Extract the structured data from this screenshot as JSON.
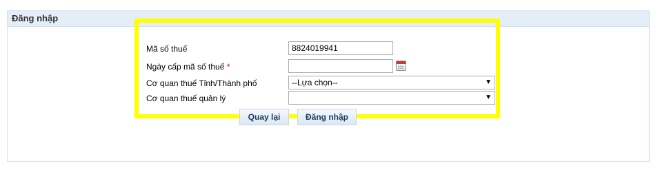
{
  "panel": {
    "title": "Đăng nhập"
  },
  "form": {
    "tax_code_label": "Mã số thuế",
    "tax_code_value": "8824019941",
    "issue_date_label": "Ngày cấp mã số thuế",
    "issue_date_required_mark": "*",
    "issue_date_value": "",
    "province_label": "Cơ quan thuế Tỉnh/Thành phố",
    "province_selected": "--Lựa chọn--",
    "managing_label": "Cơ quan thuế quản lý",
    "managing_selected": "",
    "back_button": "Quay lại",
    "login_button": "Đăng nhập"
  },
  "colors": {
    "highlight": "#ffff00",
    "required": "#d40000",
    "header_bg": "#e3eef7"
  }
}
